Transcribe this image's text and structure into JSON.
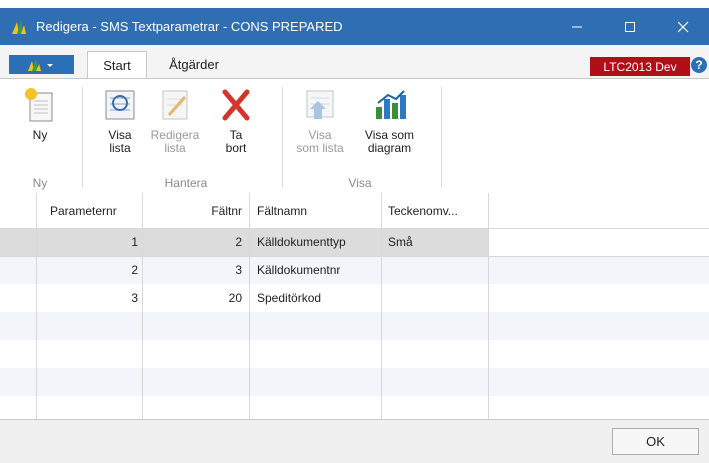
{
  "window": {
    "title": "Redigera - SMS Textparametrar - CONS PREPARED",
    "controls": {
      "minimize_icon": "minimize-icon",
      "maximize_icon": "maximize-icon",
      "close_icon": "close-icon"
    },
    "titlebar_color": "#2f6eb3"
  },
  "tabs": [
    {
      "label": "Start",
      "active": true
    },
    {
      "label": "Åtgärder",
      "active": false
    }
  ],
  "environment_badge": {
    "label": "LTC2013 Dev",
    "color": "#b10e19"
  },
  "help": {
    "label": "?"
  },
  "ribbon": {
    "groups": [
      {
        "label": "Ny",
        "buttons": [
          {
            "label_line1": "Ny",
            "label_line2": "",
            "icon": "new-document-icon",
            "enabled": true
          }
        ]
      },
      {
        "label": "Hantera",
        "buttons": [
          {
            "label_line1": "Visa",
            "label_line2": "lista",
            "icon": "view-list-icon",
            "enabled": true
          },
          {
            "label_line1": "Redigera",
            "label_line2": "lista",
            "icon": "edit-list-icon",
            "enabled": false
          },
          {
            "label_line1": "Ta",
            "label_line2": "bort",
            "icon": "delete-icon",
            "enabled": true
          }
        ]
      },
      {
        "label": "Visa",
        "buttons": [
          {
            "label_line1": "Visa",
            "label_line2": "som lista",
            "icon": "show-as-list-icon",
            "enabled": false
          },
          {
            "label_line1": "Visa som",
            "label_line2": "diagram",
            "icon": "show-as-chart-icon",
            "enabled": true
          }
        ]
      }
    ]
  },
  "grid": {
    "columns": [
      "Parameternr",
      "Fältnr",
      "Fältnamn",
      "Teckenomv..."
    ],
    "rows": [
      {
        "parameternr": "1",
        "faltnr": "2",
        "faltnamn": "Källdokumenttyp",
        "teckenomv": "Små",
        "selected": true
      },
      {
        "parameternr": "2",
        "faltnr": "3",
        "faltnamn": "Källdokumentnr",
        "teckenomv": "",
        "selected": false
      },
      {
        "parameternr": "3",
        "faltnr": "20",
        "faltnamn": "Speditörkod",
        "teckenomv": "",
        "selected": false
      }
    ]
  },
  "footer": {
    "ok_label": "OK"
  }
}
